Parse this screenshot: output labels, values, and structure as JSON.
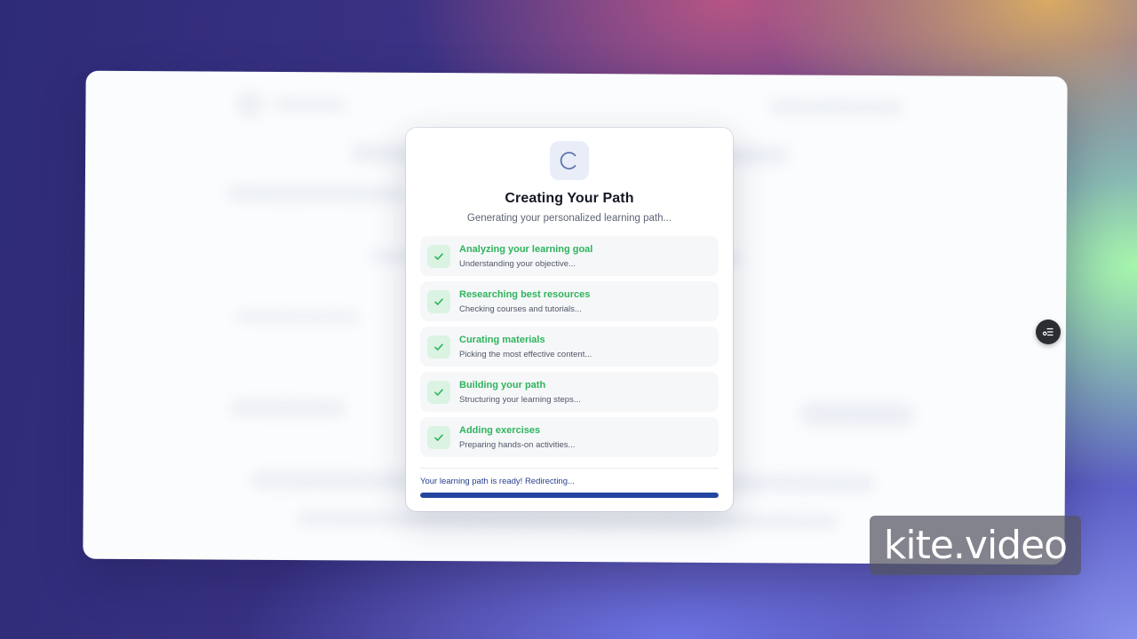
{
  "modal": {
    "title": "Creating Your Path",
    "subtitle": "Generating your personalized learning path...",
    "spinner_icon": "loading-spinner-icon",
    "steps": [
      {
        "title": "Analyzing your learning goal",
        "description": "Understanding your objective...",
        "status": "complete"
      },
      {
        "title": "Researching best resources",
        "description": "Checking courses and tutorials...",
        "status": "complete"
      },
      {
        "title": "Curating materials",
        "description": "Picking the most effective content...",
        "status": "complete"
      },
      {
        "title": "Building your path",
        "description": "Structuring your learning steps...",
        "status": "complete"
      },
      {
        "title": "Adding exercises",
        "description": "Preparing hands-on activities...",
        "status": "complete"
      }
    ],
    "status_text": "Your learning path is ready! Redirecting...",
    "progress": 1.0
  },
  "floating_button": {
    "icon": "list-settings-icon"
  },
  "watermark": {
    "text": "kite.video"
  },
  "colors": {
    "accent": "#2546a0",
    "success": "#2fb45c",
    "success_bg": "#dbf3e2",
    "title": "#141824"
  }
}
